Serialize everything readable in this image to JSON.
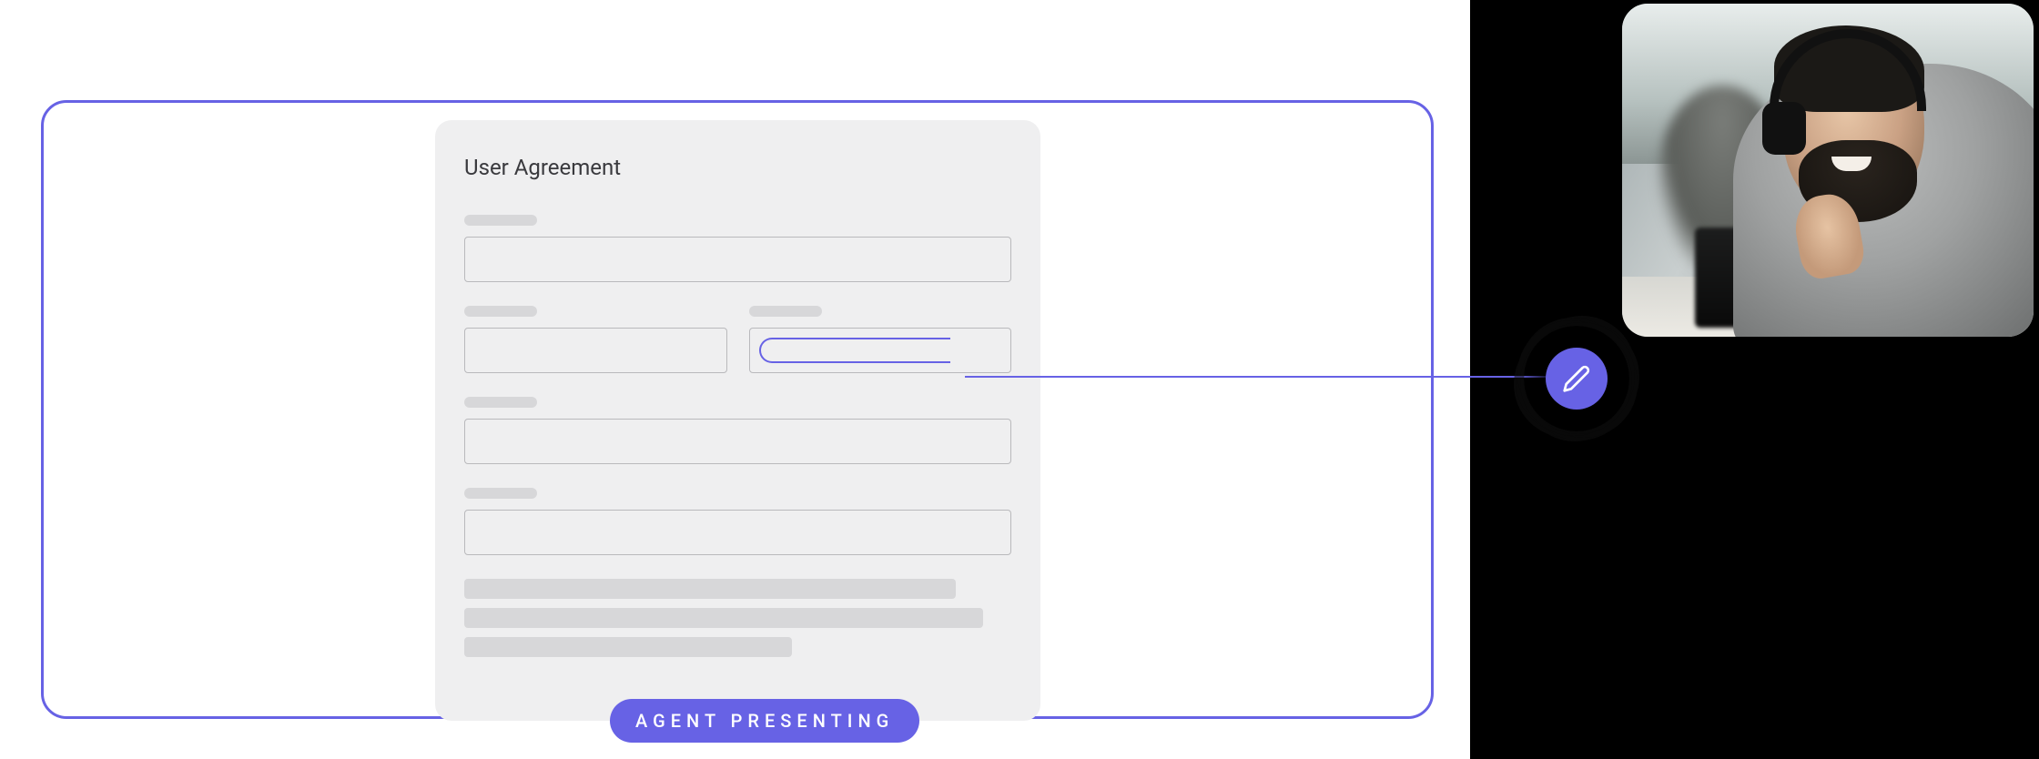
{
  "form": {
    "title": "User Agreement"
  },
  "status": {
    "label": "AGENT PRESENTING"
  },
  "edit_button": {
    "icon": "pencil-icon"
  },
  "colors": {
    "accent": "#6762E5"
  }
}
